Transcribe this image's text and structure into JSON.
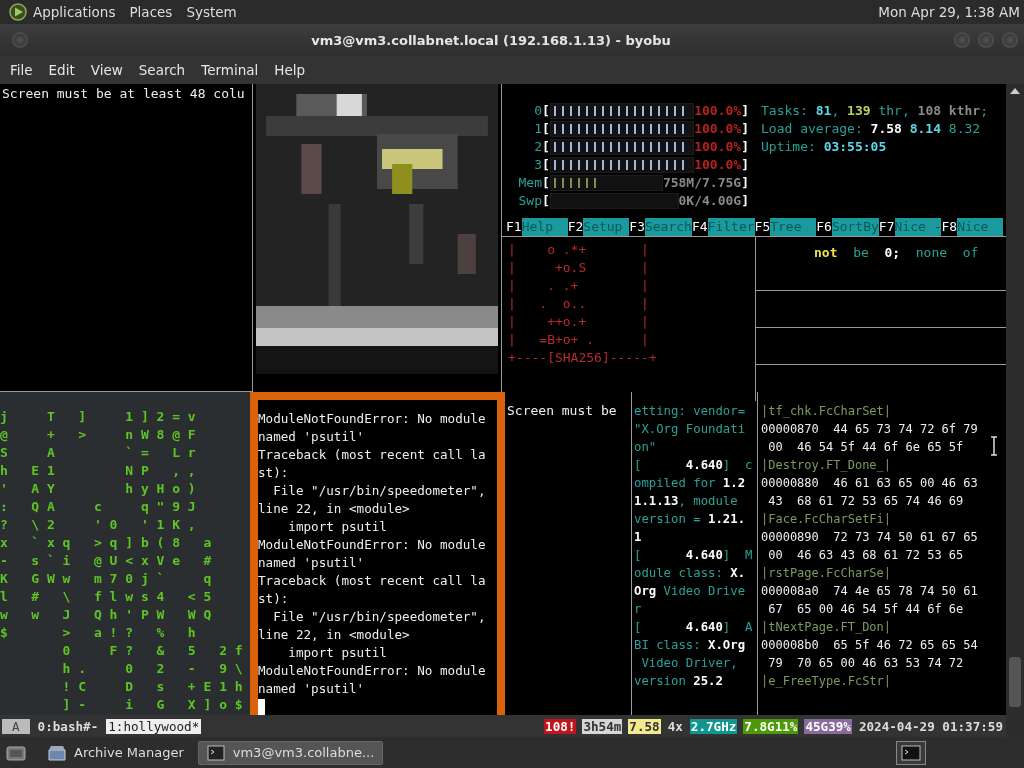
{
  "top_panel": {
    "menus": [
      "Applications",
      "Places",
      "System"
    ],
    "clock": "Mon Apr 29, 1:38 AM"
  },
  "window": {
    "title": "vm3@vm3.collabnet.local (192.168.1.13) - byobu"
  },
  "menu_bar": [
    "File",
    "Edit",
    "View",
    "Search",
    "Terminal",
    "Help"
  ],
  "pane_warning": {
    "text": "Screen must be at least 48 colu"
  },
  "htop": {
    "brackets": [
      "[",
      "]"
    ],
    "meters": [
      {
        "label": "0",
        "level": 1,
        "reading": "100.0%"
      },
      {
        "label": "1",
        "level": 1,
        "reading": "100.0%"
      },
      {
        "label": "2",
        "level": 1,
        "reading": "100.0%"
      },
      {
        "label": "3",
        "level": 1,
        "reading": "100.0%"
      },
      {
        "label": "Mem",
        "level": 0.45,
        "reading": "758M/7.75G"
      },
      {
        "label": "Swp",
        "reading": "0K/4.00G"
      }
    ],
    "stats": [
      [
        {
          "text": "Tasks: ",
          "kind": "dim"
        },
        {
          "text": "81",
          "kind": "bright"
        },
        {
          "text": ", ",
          "kind": "dim"
        },
        {
          "text": "139",
          "kind": "lime"
        },
        {
          "text": " thr, ",
          "kind": "dim"
        },
        {
          "text": "108 kthr",
          "kind": "gray"
        },
        {
          "text": ";",
          "kind": "dim"
        }
      ],
      [
        {
          "text": "Load average: ",
          "kind": "dim"
        },
        {
          "text": "7.58",
          "kind": "white"
        },
        {
          "text": " 8.14",
          "kind": "bright"
        },
        {
          "text": " 8.32",
          "kind": "dim"
        }
      ],
      [
        {
          "text": "Uptime: ",
          "kind": "dim"
        },
        {
          "text": "03:55:05",
          "kind": "bright"
        }
      ]
    ],
    "keys": [
      {
        "key": "F1",
        "label": "Help"
      },
      {
        "key": "F2",
        "label": "Setup"
      },
      {
        "key": "F3",
        "label": "Search"
      },
      {
        "key": "F4",
        "label": "Filter"
      },
      {
        "key": "F5",
        "label": "Tree"
      },
      {
        "key": "F6",
        "label": "SortBy"
      },
      {
        "key": "F7",
        "label": "Nice -"
      },
      {
        "key": "F8",
        "label": "Nice"
      }
    ]
  },
  "randomart": [
    "|    o .*+       |",
    "|     +o.S       |",
    "|    . .+        |",
    "|   .  o..       |",
    "|    ++o.+       |",
    "|   =B+o+ .      |",
    "+----[SHA256]-----+"
  ],
  "pane_words": [
    {
      "text": "not",
      "kind": "yellow"
    },
    {
      "text": "  be  ",
      "kind": "dim"
    },
    {
      "text": "0;",
      "kind": "white"
    },
    {
      "text": "  none  of",
      "kind": "dim"
    }
  ],
  "matrix": [
    "j     T   ]     1 ] 2 = v",
    "@     +   >     n W 8 @ F",
    "S     A         ` =   L r",
    "h   E 1         N P   , ,",
    "'   A Y         h y H o )",
    ":   Q A     c     q \" 9 J",
    "?   \\ 2     ' 0   ' 1 K ,",
    "x   ` x q   > q ] b ( 8   a",
    "-   s ` i   @ U < x V e   #",
    "K   G W w   m 7 0 j `     q",
    "l   #   \\   f l w s 4   < 5",
    "w   w   J   Q h ' P W   W Q",
    "$       >   a ! ?   %   h",
    "        0     F ?   &   5   2 f",
    "        h .     0   2   -   9 \\",
    "        ! C     D   s   + E 1 h",
    "        ] -     i   G   X ] o $"
  ],
  "traceback": [
    "ModuleNotFoundError: No module",
    "named 'psutil'",
    "Traceback (most recent call la",
    "st):",
    "  File \"/usr/bin/speedometer\",",
    "line 22, in <module>",
    "    import psutil",
    "ModuleNotFoundError: No module",
    "named 'psutil'",
    "Traceback (most recent call la",
    "st):",
    "  File \"/usr/bin/speedometer\",",
    "line 22, in <module>",
    "    import psutil",
    "ModuleNotFoundError: No module",
    "named 'psutil'"
  ],
  "pane_warning_2": {
    "text": "Screen must be"
  },
  "dmesg": [
    "etting: vendor=",
    "\"X.Org Foundati",
    "on\"",
    "[      **4.640**]  c",
    "ompiled for **1.2**",
    "**1.1.13**, module",
    "version = **1.21.**",
    "**1**",
    "[      **4.640**]  M",
    "odule class: **X.**",
    "**Org** Video Drive",
    "r",
    "[      **4.640**]  A",
    "BI class: **X.Org**",
    " Video Driver,",
    "version **25.2**"
  ],
  "hexdump": [
    {
      "kind": "ascii",
      "text": "|tf_chk.FcCharSet|"
    },
    {
      "kind": "hex",
      "text": "00000870  44 65 73 74 72 6f 79"
    },
    {
      "kind": "hex",
      "text": " 00  46 54 5f 44 6f 6e 65 5f"
    },
    {
      "kind": "ascii",
      "text": "|Destroy.FT_Done_|"
    },
    {
      "kind": "hex",
      "text": "00000880  46 61 63 65 00 46 63"
    },
    {
      "kind": "hex",
      "text": " 43  68 61 72 53 65 74 46 69"
    },
    {
      "kind": "ascii",
      "text": "|Face.FcCharSetFi|"
    },
    {
      "kind": "hex",
      "text": "00000890  72 73 74 50 61 67 65"
    },
    {
      "kind": "hex",
      "text": " 00  46 63 43 68 61 72 53 65"
    },
    {
      "kind": "ascii",
      "text": "|rstPage.FcCharSe|"
    },
    {
      "kind": "hex",
      "text": "000008a0  74 4e 65 78 74 50 61"
    },
    {
      "kind": "hex",
      "text": " 67  65 00 46 54 5f 44 6f 6e"
    },
    {
      "kind": "ascii",
      "text": "|tNextPage.FT_Don|"
    },
    {
      "kind": "hex",
      "text": "000008b0  65 5f 46 72 65 65 54"
    },
    {
      "kind": "hex",
      "text": " 79  70 65 00 46 63 53 74 72"
    },
    {
      "kind": "ascii",
      "text": "|e_FreeType.FcStr|"
    }
  ],
  "status_bar": {
    "session": "A",
    "windows": [
      {
        "label": "0:bash#-",
        "selected": false
      },
      {
        "label": "1:hollywood*",
        "selected": true
      }
    ],
    "items": [
      {
        "text": "108!",
        "color": "#c0151b"
      },
      {
        "text": "3h54m",
        "color": "#d6d6d6"
      },
      {
        "text": "7.58",
        "color": "#f3e98e"
      },
      {
        "text": "4x"
      },
      {
        "text": "2.7GHz",
        "color": "#10968f"
      },
      {
        "text": "7.8G11%",
        "color": "#4e9a06"
      },
      {
        "text": "45G39%",
        "color": "#8a6a9a"
      },
      {
        "text": "2024-04-29 01:37:59"
      }
    ]
  },
  "taskbar": {
    "tasks": [
      {
        "label": "Archive Manager",
        "selected": false
      },
      {
        "label": "vm3@vm3.collabne...",
        "selected": true
      }
    ]
  }
}
